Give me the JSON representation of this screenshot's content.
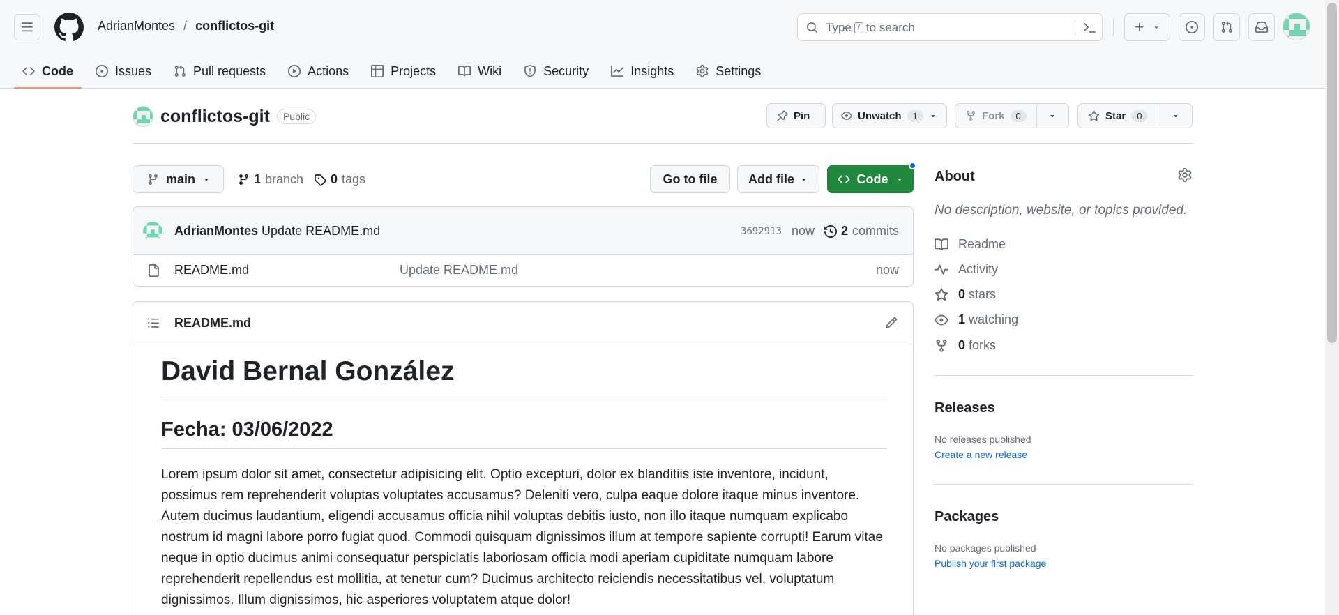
{
  "header": {
    "owner": "AdrianMontes",
    "separator": "/",
    "repo": "conflictos-git",
    "search": {
      "placeholder_before": "Type",
      "placeholder_key": "/",
      "placeholder_after": "to search"
    }
  },
  "tabs": [
    {
      "label": "Code",
      "icon": "code-icon",
      "active": true
    },
    {
      "label": "Issues",
      "icon": "issue-icon"
    },
    {
      "label": "Pull requests",
      "icon": "pull-request-icon"
    },
    {
      "label": "Actions",
      "icon": "play-icon"
    },
    {
      "label": "Projects",
      "icon": "table-icon"
    },
    {
      "label": "Wiki",
      "icon": "book-icon"
    },
    {
      "label": "Security",
      "icon": "shield-icon"
    },
    {
      "label": "Insights",
      "icon": "graph-icon"
    },
    {
      "label": "Settings",
      "icon": "gear-icon"
    }
  ],
  "repo": {
    "name": "conflictos-git",
    "visibility": "Public",
    "pin_label": "Pin",
    "unwatch_label": "Unwatch",
    "watch_count": "1",
    "fork_label": "Fork",
    "fork_count": "0",
    "star_label": "Star",
    "star_count": "0"
  },
  "branch_bar": {
    "branch": "main",
    "branch_count": "1",
    "branch_word": "branch",
    "tag_count": "0",
    "tag_word": "tags",
    "go_to_file": "Go to file",
    "add_file": "Add file",
    "code": "Code"
  },
  "latest_commit": {
    "author": "AdrianMontes",
    "message": "Update README.md",
    "sha": "3692913",
    "time": "now",
    "commit_count": "2",
    "commit_word": "commits"
  },
  "files": [
    {
      "name": "README.md",
      "message": "Update README.md",
      "time": "now",
      "icon": "file-icon"
    }
  ],
  "readme": {
    "filename": "README.md",
    "h1": "David Bernal González",
    "h2": "Fecha: 03/06/2022",
    "paragraph": "Lorem ipsum dolor sit amet, consectetur adipisicing elit. Optio excepturi, dolor ex blanditiis iste inventore, incidunt, possimus rem reprehenderit voluptas voluptates accusamus? Deleniti vero, culpa eaque dolore itaque minus inventore. Autem ducimus laudantium, eligendi accusamus officia nihil voluptas debitis iusto, non illo itaque numquam explicabo nostrum id magni labore porro fugiat quod. Commodi quisquam dignissimos illum at tempore sapiente corrupti! Earum vitae neque in optio ducimus animi consequatur perspiciatis laboriosam officia modi aperiam cupiditate numquam labore reprehenderit repellendus est mollitia, at tenetur cum? Ducimus architecto reiciendis necessitatibus vel, voluptatum dignissimos. Illum dignissimos, hic asperiores voluptatem atque dolor!"
  },
  "about": {
    "title": "About",
    "description": "No description, website, or topics provided.",
    "readme": "Readme",
    "activity": "Activity",
    "stars_count": "0",
    "stars_word": "stars",
    "watching_count": "1",
    "watching_word": "watching",
    "forks_count": "0",
    "forks_word": "forks"
  },
  "releases": {
    "title": "Releases",
    "empty": "No releases published",
    "link": "Create a new release"
  },
  "packages": {
    "title": "Packages",
    "empty": "No packages published",
    "link": "Publish your first package"
  },
  "colors": {
    "accent_green": "#1f883d",
    "link_blue": "#0969da",
    "tab_underline": "#fd8c73",
    "identicon": "#6fd6b4"
  }
}
